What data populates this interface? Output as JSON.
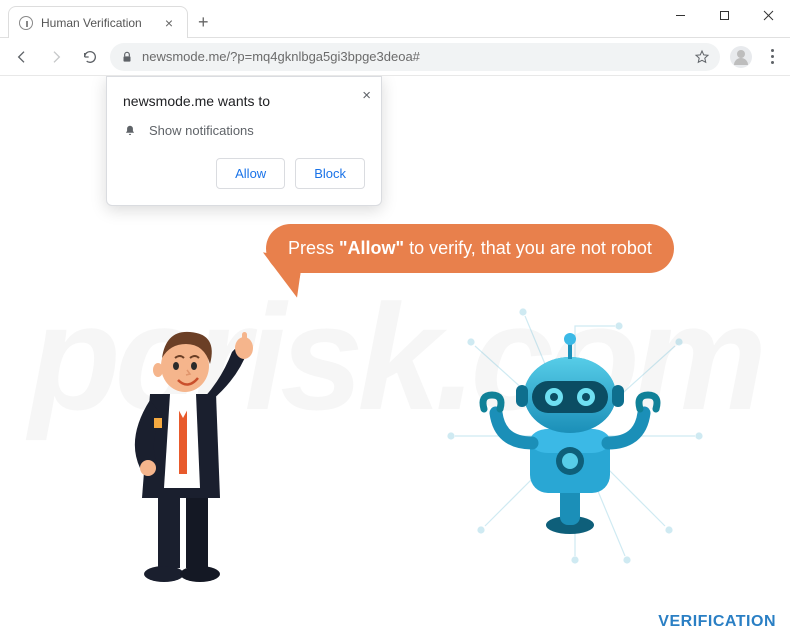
{
  "tab": {
    "title": "Human Verification"
  },
  "url": "newsmode.me/?p=mq4gknlbga5gi3bpge3deoa#",
  "permission": {
    "title": "newsmode.me wants to",
    "item": "Show notifications",
    "allow": "Allow",
    "block": "Block"
  },
  "bubble": {
    "pre": "Press ",
    "strong": "\"Allow\"",
    "post": " to verify, that you are not robot"
  },
  "footer": {
    "label": "VERIFICATION"
  },
  "watermark": {
    "text": "pcrisk.com"
  }
}
